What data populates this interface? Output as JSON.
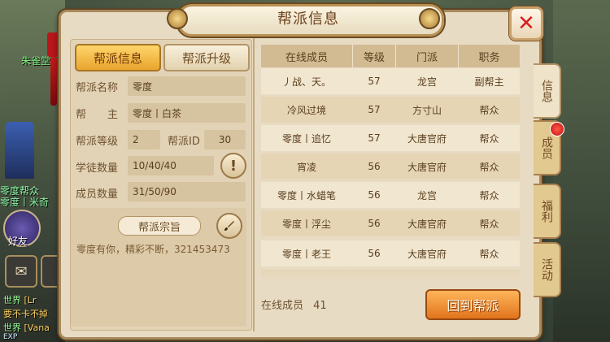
{
  "background": {
    "npc_name": "朱雀堂",
    "npc_guild_line1": "零度帮众",
    "npc_guild_line2": "零度丨米奇",
    "friends_label": "好友",
    "chat": [
      {
        "channel": "世界",
        "text": "[Lr"
      },
      {
        "channel": "",
        "text": "要不卡不掉"
      },
      {
        "channel": "世界",
        "text": "[Vana"
      }
    ],
    "exp_label": "EXP"
  },
  "window": {
    "title": "帮派信息",
    "close_icon": "close-x-icon"
  },
  "left_tabs": [
    {
      "label": "帮派信息",
      "active": true
    },
    {
      "label": "帮派升级",
      "active": false
    }
  ],
  "guild": {
    "name_label": "帮派名称",
    "name_value": "零度",
    "leader_label": "帮　　主",
    "leader_value": "零度丨白茶",
    "level_label": "帮派等级",
    "level_value": "2",
    "id_label": "帮派ID",
    "id_value": "30",
    "apprentice_label": "学徒数量",
    "apprentice_value": "10/40/40",
    "member_label": "成员数量",
    "member_value": "31/50/90",
    "motto_title": "帮派宗旨",
    "motto_text": "零度有你，精彩不断，321453473"
  },
  "table": {
    "headers": [
      "在线成员",
      "等级",
      "门派",
      "职务"
    ],
    "rows": [
      [
        "丿战、天。",
        "57",
        "龙宫",
        "副帮主"
      ],
      [
        "冷风过境",
        "57",
        "方寸山",
        "帮众"
      ],
      [
        "零度丨追忆",
        "57",
        "大唐官府",
        "帮众"
      ],
      [
        "宵凌",
        "56",
        "大唐官府",
        "帮众"
      ],
      [
        "零度丨水蜡笔",
        "56",
        "龙宫",
        "帮众"
      ],
      [
        "零度丨浮尘",
        "56",
        "大唐官府",
        "帮众"
      ],
      [
        "零度丨老王",
        "56",
        "大唐官府",
        "帮众"
      ]
    ]
  },
  "footer": {
    "online_label": "在线成员",
    "online_count": "41",
    "return_button": "回到帮派"
  },
  "right_tabs": [
    {
      "label": "信息",
      "active": true
    },
    {
      "label": "成员",
      "active": false,
      "badge": true
    },
    {
      "label": "福利",
      "active": false
    },
    {
      "label": "活动",
      "active": false
    }
  ],
  "colors": {
    "accent_orange": "#e0741c",
    "active_tab_gold": "#ffd56b",
    "close_red": "#d82020",
    "text_brown": "#5a3f1e"
  }
}
